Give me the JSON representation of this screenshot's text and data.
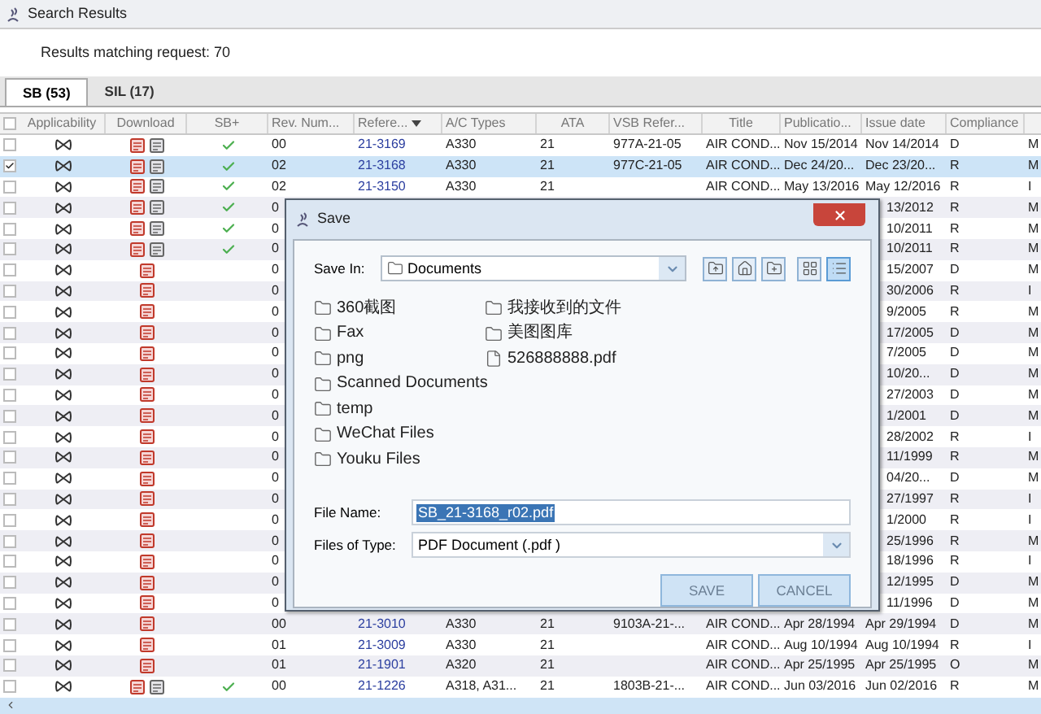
{
  "window": {
    "title": "Search Results"
  },
  "results_text": "Results matching request: 70",
  "tabs": [
    {
      "label": "SB (53)",
      "selected": true
    },
    {
      "label": "SIL (17)",
      "selected": false
    }
  ],
  "table": {
    "select_all_checked": false,
    "columns": [
      "Applicability",
      "Download",
      "SB+",
      "Rev. Num...",
      "Refere...",
      "A/C Types",
      "ATA",
      "VSB Refer...",
      "Title",
      "Publicatio...",
      "Issue date",
      "Compliance"
    ],
    "rows": [
      {
        "kind": "full",
        "checked": false,
        "selected": false,
        "pdf": true,
        "sb_document": true,
        "sb_plus": true,
        "rev": "00",
        "reference": "21-3169",
        "ac_types": "A330",
        "ata": "21",
        "vsb_reference": "977A-21-05",
        "title": "AIR COND...",
        "publication": "Nov 15/2014",
        "issue_date": "Nov 14/2014",
        "compliance": "D",
        "column_14": "M"
      },
      {
        "kind": "full",
        "checked": true,
        "selected": true,
        "pdf": true,
        "sb_document": true,
        "sb_plus": true,
        "rev": "02",
        "reference": "21-3168",
        "ac_types": "A330",
        "ata": "21",
        "vsb_reference": "977C-21-05",
        "title": "AIR COND...",
        "publication": "Dec 24/20...",
        "issue_date": "Dec 23/20...",
        "compliance": "R",
        "column_14": "M"
      },
      {
        "kind": "full",
        "checked": false,
        "selected": false,
        "pdf": true,
        "sb_document": true,
        "sb_plus": true,
        "rev": "02",
        "reference": "21-3150",
        "ac_types": "A330",
        "ata": "21",
        "title": "AIR COND...",
        "publication": "May 13/2016",
        "issue_date": "May 12/2016",
        "compliance": "R",
        "column_14": "I"
      },
      {
        "kind": "covered",
        "checked": false,
        "selected": false,
        "pdf": true,
        "sb_document": true,
        "sb_plus": true,
        "rev": "0",
        "issue_date": "13/2012",
        "compliance": "R",
        "column_14": "M"
      },
      {
        "kind": "covered",
        "checked": false,
        "selected": false,
        "pdf": true,
        "sb_document": true,
        "sb_plus": true,
        "rev": "0",
        "issue_date": "10/2011",
        "compliance": "R",
        "column_14": "M"
      },
      {
        "kind": "covered",
        "checked": false,
        "selected": false,
        "pdf": true,
        "sb_document": true,
        "sb_plus": true,
        "rev": "0",
        "issue_date": "10/2011",
        "compliance": "R",
        "column_14": "M"
      },
      {
        "kind": "covered",
        "checked": false,
        "selected": false,
        "pdf": true,
        "sb_document": false,
        "sb_plus": false,
        "rev": "0",
        "issue_date": "15/2007",
        "compliance": "D",
        "column_14": "M"
      },
      {
        "kind": "covered",
        "checked": false,
        "selected": false,
        "pdf": true,
        "sb_document": false,
        "sb_plus": false,
        "rev": "0",
        "issue_date": "30/2006",
        "compliance": "R",
        "column_14": "I"
      },
      {
        "kind": "covered",
        "checked": false,
        "selected": false,
        "pdf": true,
        "sb_document": false,
        "sb_plus": false,
        "rev": "0",
        "issue_date": "9/2005",
        "compliance": "R",
        "column_14": "M"
      },
      {
        "kind": "covered",
        "checked": false,
        "selected": false,
        "pdf": true,
        "sb_document": false,
        "sb_plus": false,
        "rev": "0",
        "issue_date": "17/2005",
        "compliance": "D",
        "column_14": "M"
      },
      {
        "kind": "covered",
        "checked": false,
        "selected": false,
        "pdf": true,
        "sb_document": false,
        "sb_plus": false,
        "rev": "0",
        "issue_date": "7/2005",
        "compliance": "D",
        "column_14": "M"
      },
      {
        "kind": "covered",
        "checked": false,
        "selected": false,
        "pdf": true,
        "sb_document": false,
        "sb_plus": false,
        "rev": "0",
        "issue_date": "10/20...",
        "compliance": "D",
        "column_14": "M"
      },
      {
        "kind": "covered",
        "checked": false,
        "selected": false,
        "pdf": true,
        "sb_document": false,
        "sb_plus": false,
        "rev": "0",
        "issue_date": "27/2003",
        "compliance": "D",
        "column_14": "M"
      },
      {
        "kind": "covered",
        "checked": false,
        "selected": false,
        "pdf": true,
        "sb_document": false,
        "sb_plus": false,
        "rev": "0",
        "issue_date": "1/2001",
        "compliance": "D",
        "column_14": "M"
      },
      {
        "kind": "covered",
        "checked": false,
        "selected": false,
        "pdf": true,
        "sb_document": false,
        "sb_plus": false,
        "rev": "0",
        "issue_date": "28/2002",
        "compliance": "R",
        "column_14": "I"
      },
      {
        "kind": "covered",
        "checked": false,
        "selected": false,
        "pdf": true,
        "sb_document": false,
        "sb_plus": false,
        "rev": "0",
        "issue_date": "11/1999",
        "compliance": "R",
        "column_14": "M"
      },
      {
        "kind": "covered",
        "checked": false,
        "selected": false,
        "pdf": true,
        "sb_document": false,
        "sb_plus": false,
        "rev": "0",
        "issue_date": "04/20...",
        "compliance": "D",
        "column_14": "M"
      },
      {
        "kind": "covered",
        "checked": false,
        "selected": false,
        "pdf": true,
        "sb_document": false,
        "sb_plus": false,
        "rev": "0",
        "issue_date": "27/1997",
        "compliance": "R",
        "column_14": "I"
      },
      {
        "kind": "covered",
        "checked": false,
        "selected": false,
        "pdf": true,
        "sb_document": false,
        "sb_plus": false,
        "rev": "0",
        "issue_date": "1/2000",
        "compliance": "R",
        "column_14": "I"
      },
      {
        "kind": "covered",
        "checked": false,
        "selected": false,
        "pdf": true,
        "sb_document": false,
        "sb_plus": false,
        "rev": "0",
        "issue_date": "25/1996",
        "compliance": "R",
        "column_14": "M"
      },
      {
        "kind": "covered",
        "checked": false,
        "selected": false,
        "pdf": true,
        "sb_document": false,
        "sb_plus": false,
        "rev": "0",
        "issue_date": "18/1996",
        "compliance": "R",
        "column_14": "I"
      },
      {
        "kind": "covered",
        "checked": false,
        "selected": false,
        "pdf": true,
        "sb_document": false,
        "sb_plus": false,
        "rev": "0",
        "issue_date": "12/1995",
        "compliance": "D",
        "column_14": "M"
      },
      {
        "kind": "covered",
        "checked": false,
        "selected": false,
        "pdf": true,
        "sb_document": false,
        "sb_plus": false,
        "rev": "0",
        "issue_date": "11/1996",
        "compliance": "D",
        "column_14": "M"
      },
      {
        "kind": "full",
        "checked": false,
        "selected": false,
        "pdf": true,
        "sb_document": false,
        "sb_plus": false,
        "rev": "00",
        "reference": "21-3010",
        "ac_types": "A330",
        "ata": "21",
        "vsb_reference": "9103A-21-...",
        "title": "AIR COND...",
        "publication": "Apr 28/1994",
        "issue_date": "Apr 29/1994",
        "compliance": "D",
        "column_14": "M"
      },
      {
        "kind": "full",
        "checked": false,
        "selected": false,
        "pdf": true,
        "sb_document": false,
        "sb_plus": false,
        "rev": "01",
        "reference": "21-3009",
        "ac_types": "A330",
        "ata": "21",
        "title": "AIR COND...",
        "publication": "Aug 10/1994",
        "issue_date": "Aug 10/1994",
        "compliance": "R",
        "column_14": "I"
      },
      {
        "kind": "full",
        "checked": false,
        "selected": false,
        "pdf": true,
        "sb_document": false,
        "sb_plus": false,
        "rev": "01",
        "reference": "21-1901",
        "ac_types": "A320",
        "ata": "21",
        "title": "AIR COND...",
        "publication": "Apr 25/1995",
        "issue_date": "Apr 25/1995",
        "compliance": "O",
        "column_14": "M"
      },
      {
        "kind": "full",
        "checked": false,
        "selected": false,
        "pdf": true,
        "sb_document": true,
        "sb_plus": true,
        "rev": "00",
        "reference": "21-1226",
        "ac_types": "A318, A31...",
        "ata": "21",
        "vsb_reference": "1803B-21-...",
        "title": "AIR COND...",
        "publication": "Jun 03/2016",
        "issue_date": "Jun 02/2016",
        "compliance": "R",
        "column_14": "M"
      }
    ]
  },
  "dialog": {
    "title": "Save",
    "save_in_label": "Save In:",
    "save_in_value": "Documents",
    "view_buttons": [
      {
        "kind": "list",
        "selected": false
      },
      {
        "kind": "details",
        "selected": true
      }
    ],
    "files": [
      {
        "kind": "folder",
        "name": "360截图"
      },
      {
        "kind": "folder",
        "name": "Fax"
      },
      {
        "kind": "folder",
        "name": "png"
      },
      {
        "kind": "folder",
        "name": "Scanned Documents"
      },
      {
        "kind": "folder",
        "name": "temp"
      },
      {
        "kind": "folder",
        "name": "WeChat Files"
      },
      {
        "kind": "folder",
        "name": "Youku Files"
      },
      {
        "kind": "folder",
        "name": "我接收到的文件"
      },
      {
        "kind": "folder",
        "name": "美图图库"
      },
      {
        "kind": "file",
        "name": "526888888.pdf"
      }
    ],
    "file_name_label": "File Name:",
    "file_name_value": "SB_21-3168_r02.pdf",
    "file_type_label": "Files of Type:",
    "file_type_value": "PDF Document (.pdf )",
    "buttons": [
      "SAVE",
      "CANCEL"
    ]
  }
}
